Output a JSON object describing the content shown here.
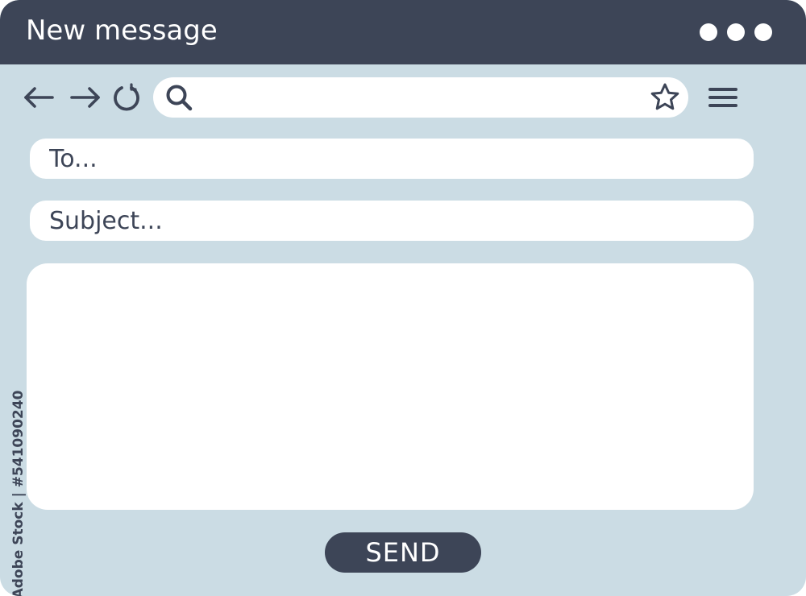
{
  "window": {
    "title": "New message",
    "background_color": "#cbdce4",
    "titlebar_color": "#3d4557",
    "dot_menu_icon": "three-dots-icon"
  },
  "toolbar": {
    "back_icon": "arrow-left-icon",
    "forward_icon": "arrow-right-icon",
    "reload_icon": "reload-icon",
    "search_icon": "search-icon",
    "search_value": "",
    "bookmark_icon": "star-icon",
    "menu_icon": "hamburger-menu-icon"
  },
  "compose": {
    "to_placeholder": "To...",
    "to_value": "",
    "subject_placeholder": "Subject...",
    "subject_value": "",
    "body_value": "",
    "send_label": "SEND"
  },
  "watermark": {
    "stock_id": "Adobe Stock | #541090240"
  }
}
